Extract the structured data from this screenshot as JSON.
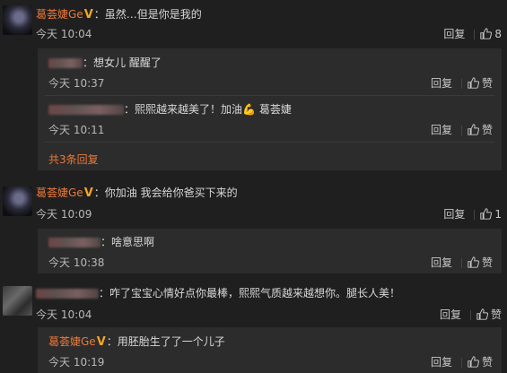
{
  "comments": [
    {
      "user": "葛荟婕Ge",
      "text": "虽然…但是你是我的",
      "time": "今天 10:04",
      "reply_label": "回复",
      "likes": "8",
      "replies": [
        {
          "text": "想女儿 醒醒了",
          "time": "今天 10:37",
          "reply_label": "回复",
          "like_label": "赞"
        },
        {
          "text": "熙熙越来越美了！加油",
          "emoji": "💪",
          "mention": "葛荟婕",
          "time": "今天 10:11",
          "reply_label": "回复",
          "like_label": "赞"
        }
      ],
      "more_label": "共3条回复"
    },
    {
      "user": "葛荟婕Ge",
      "text": "你加油 我会给你爸买下来的",
      "time": "今天 10:09",
      "reply_label": "回复",
      "likes": "1",
      "replies": [
        {
          "text": "啥意思啊",
          "time": "今天 10:38",
          "reply_label": "回复",
          "like_label": "赞"
        }
      ]
    },
    {
      "text": "咋了宝宝心情好点你最棒，熙熙气质越来越想你。腿长人美！",
      "time": "今天 10:04",
      "reply_label": "回复",
      "like_label": "赞",
      "replies": [
        {
          "user": "葛荟婕Ge",
          "text": "用胚胎生了了一个儿子",
          "time": "今天 10:19",
          "reply_label": "回复",
          "like_label": "赞"
        }
      ]
    }
  ],
  "colors": {
    "background": "#1f1f1f",
    "reply_background": "#2c2c2c",
    "username": "#e8793a",
    "verified": "#f5a623"
  },
  "icons": [
    "thumb-up-icon",
    "verified-v-icon",
    "flexed-arm-emoji"
  ]
}
